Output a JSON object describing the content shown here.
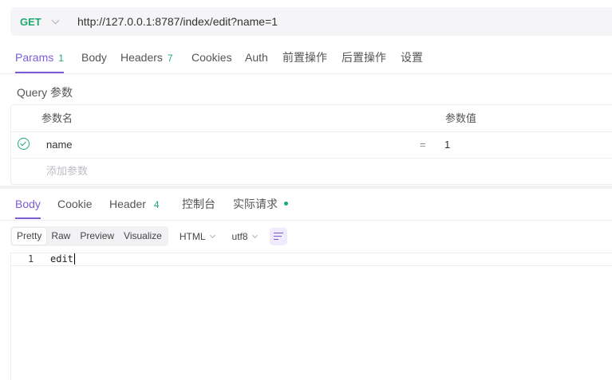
{
  "request": {
    "method": "GET",
    "url": "http://127.0.0.1:8787/index/edit?name=1"
  },
  "request_tabs": [
    {
      "label": "Params",
      "count": "1",
      "active": true
    },
    {
      "label": "Body",
      "count": ""
    },
    {
      "label": "Headers",
      "count": "7"
    },
    {
      "label": "Cookies",
      "count": ""
    },
    {
      "label": "Auth",
      "count": ""
    },
    {
      "label": "前置操作",
      "count": ""
    },
    {
      "label": "后置操作",
      "count": ""
    },
    {
      "label": "设置",
      "count": ""
    }
  ],
  "params": {
    "section_title": "Query 参数",
    "header_name": "参数名",
    "header_value": "参数值",
    "rows": [
      {
        "name": "name",
        "equals": "=",
        "value": "1",
        "enabled": true
      }
    ],
    "add_placeholder": "添加参数"
  },
  "response_tabs": [
    {
      "label": "Body",
      "count": "",
      "active": true
    },
    {
      "label": "Cookie",
      "count": ""
    },
    {
      "label": "Header",
      "count": "4"
    },
    {
      "label": "控制台",
      "count": ""
    },
    {
      "label": "实际请求",
      "count": "",
      "dot": true
    }
  ],
  "format_toolbar": {
    "modes": [
      "Pretty",
      "Raw",
      "Preview",
      "Visualize"
    ],
    "active_mode": "Pretty",
    "language": "HTML",
    "encoding": "utf8"
  },
  "response_body": {
    "lines": [
      {
        "number": "1",
        "text": "edit"
      }
    ]
  },
  "colors": {
    "accent": "#7b5cd6",
    "method_get": "#1fa971",
    "count_badge": "#1fa971"
  }
}
